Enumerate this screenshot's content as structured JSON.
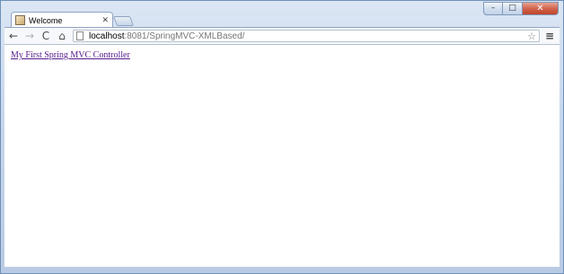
{
  "tab": {
    "title": "Welcome",
    "favicon": "page-favicon-icon",
    "close_icon": "close-icon"
  },
  "toolbar": {
    "back_icon": "←",
    "forward_icon": "→",
    "reload_icon": "C",
    "home_icon": "⌂",
    "star_icon": "☆",
    "menu_icon": "≡"
  },
  "address_bar": {
    "host": "localhost",
    "rest": ":8081/SpringMVC-XMLBased/"
  },
  "window_controls": {
    "minimize": "–",
    "maximize": "□",
    "close": "✕"
  },
  "page": {
    "link_text": "My First Spring MVC Controller",
    "link_color": "#551a8b"
  }
}
